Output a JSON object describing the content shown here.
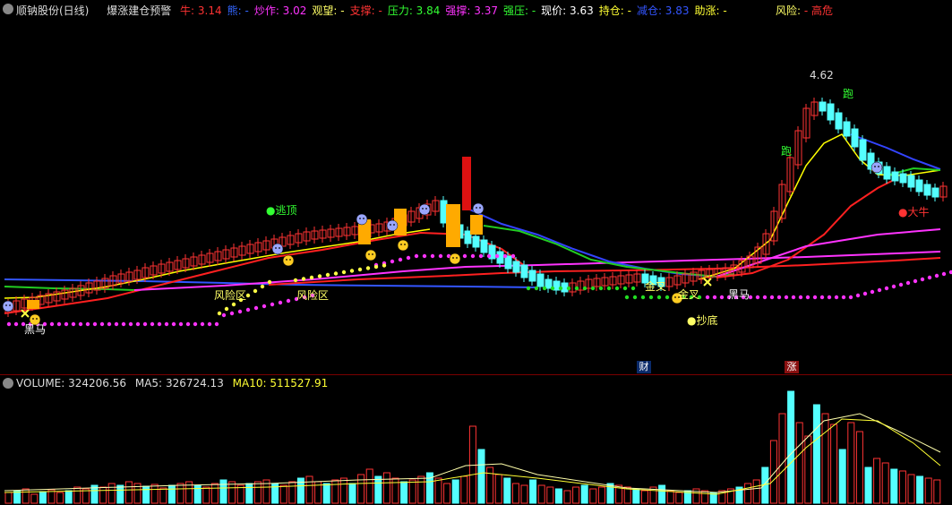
{
  "header": {
    "stock_name": "顺钠股份(日线)",
    "indicator_name": "爆涨建仓预警",
    "fields": [
      {
        "label": "牛:",
        "value": "3.14",
        "color": "#ff3333"
      },
      {
        "label": "熊:",
        "value": "-",
        "color": "#3366ff"
      },
      {
        "label": "炒作:",
        "value": "3.02",
        "color": "#ff33ff"
      },
      {
        "label": "观望:",
        "value": "-",
        "color": "#ffff66"
      },
      {
        "label": "支撑:",
        "value": "-",
        "color": "#ff3333"
      },
      {
        "label": "压力:",
        "value": "3.84",
        "color": "#33ff33"
      },
      {
        "label": "强撑:",
        "value": "3.37",
        "color": "#ff33ff"
      },
      {
        "label": "强压:",
        "value": "-",
        "color": "#33ff33"
      },
      {
        "label": "现价:",
        "value": "3.63",
        "color": "#ffffff"
      },
      {
        "label": "持仓:",
        "value": "-",
        "color": "#ffff33"
      },
      {
        "label": "减仓:",
        "value": "3.83",
        "color": "#3355ff"
      },
      {
        "label": "助涨:",
        "value": "-",
        "color": "#ffff33"
      }
    ],
    "risk_label": "风险:",
    "risk_value": "- 高危"
  },
  "volume_header": {
    "volume_label": "VOLUME:",
    "volume_value": "324206.56",
    "ma5_label": "MA5:",
    "ma5_value": "326724.13",
    "ma10_label": "MA10:",
    "ma10_value": "511527.91"
  },
  "annotations": {
    "peak_price": "4.62",
    "escape_top": "●逃顶",
    "risk_zone": "风险区",
    "dark_horse": "黑马",
    "bottom_buy": "●抄底",
    "golden_cross": "金叉",
    "run": "跑",
    "big_bull": "●大牛",
    "cai": "财",
    "zhang": "涨"
  },
  "colors": {
    "up": "#ff3333",
    "down": "#54ffff",
    "ma_yellow": "#ffff00",
    "ma_red": "#ff2020",
    "ma_magenta": "#ff33ff",
    "ma_blue": "#3030ff",
    "ma_green": "#22cc22"
  }
}
